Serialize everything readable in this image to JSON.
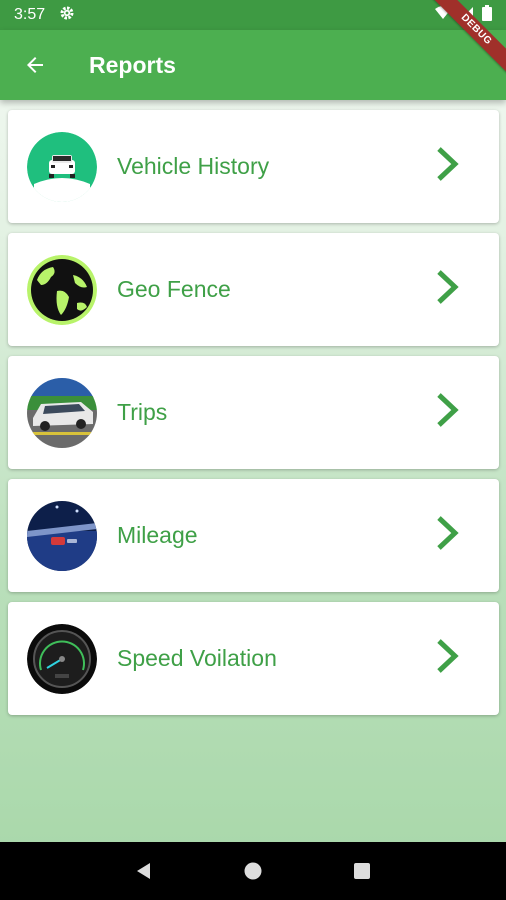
{
  "status_bar": {
    "time": "3:57"
  },
  "app_bar": {
    "title": "Reports"
  },
  "debug_banner": "DEBUG",
  "reports": [
    {
      "label": "Vehicle History",
      "icon": "car-front-icon"
    },
    {
      "label": "Geo Fence",
      "icon": "globe-icon"
    },
    {
      "label": "Trips",
      "icon": "suv-icon"
    },
    {
      "label": "Mileage",
      "icon": "racetrack-icon"
    },
    {
      "label": "Speed Voilation",
      "icon": "speedometer-icon"
    }
  ],
  "colors": {
    "primary": "#4caf50",
    "status_bar": "#3e9a43",
    "accent": "#3fa047"
  }
}
